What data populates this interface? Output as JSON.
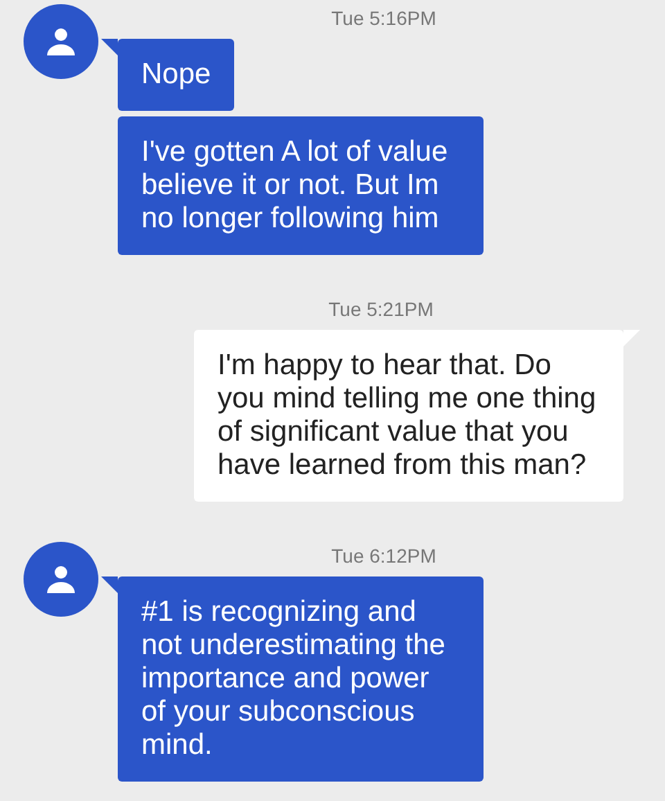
{
  "conversation": [
    {
      "kind": "them",
      "time": "Tue 5:16PM",
      "messages": [
        "Nope",
        "I've gotten A lot of value believe it or not. But Im no longer following him"
      ]
    },
    {
      "kind": "me",
      "time": "Tue 5:21PM",
      "messages": [
        "I'm happy to hear that. Do you mind telling me one thing of significant value that you have learned from this man?"
      ]
    },
    {
      "kind": "them",
      "time": "Tue 6:12PM",
      "messages": [
        "#1 is recognizing and not underestimating the importance and power of your subconscious mind."
      ]
    }
  ]
}
